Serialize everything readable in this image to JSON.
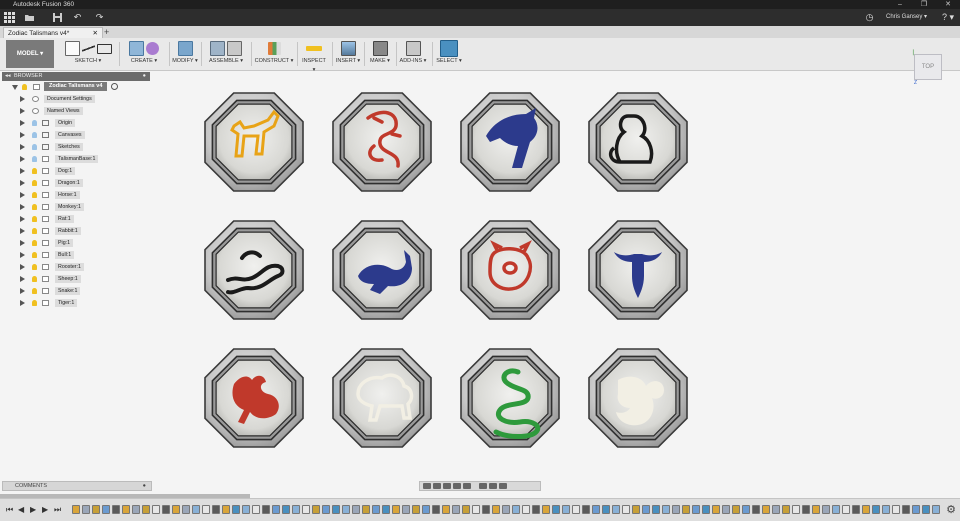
{
  "app": {
    "title": "Autodesk Fusion 360",
    "window_controls": [
      "–",
      "❐",
      "✕"
    ]
  },
  "qat": {
    "user": "Chris Gansey ▾",
    "help": "? ▾"
  },
  "tab": {
    "label": "Zodiac Talismans v4*",
    "close": "✕",
    "new_tab": "+"
  },
  "toolbar": {
    "workspace": "MODEL ▾",
    "groups": [
      "SKETCH ▾",
      "CREATE ▾",
      "MODIFY ▾",
      "ASSEMBLE ▾",
      "CONSTRUCT ▾",
      "INSPECT ▾",
      "INSERT ▾",
      "MAKE ▾",
      "ADD-INS ▾",
      "SELECT ▾"
    ]
  },
  "browser": {
    "header": "BROWSER",
    "root": "Zodiac Talismans v4",
    "items": [
      "Document Settings",
      "Named Views",
      "Origin",
      "Canvases",
      "Sketches",
      "TalismanBase:1",
      "Dog:1",
      "Dragon:1",
      "Horse:1",
      "Monkey:1",
      "Rat:1",
      "Rabbit:1",
      "Pig:1",
      "Bull:1",
      "Rooster:1",
      "Sheep:1",
      "Snake:1",
      "Tiger:1"
    ]
  },
  "viewcube": {
    "face": "TOP",
    "axis_x": "X",
    "axis_z": "Z"
  },
  "comments": {
    "label": "COMMENTS"
  },
  "talismans": [
    {
      "name": "Dog",
      "color": "#e8a317"
    },
    {
      "name": "Dragon",
      "color": "#c0392b"
    },
    {
      "name": "Horse",
      "color": "#2c3a8c"
    },
    {
      "name": "Monkey",
      "color": "#1a1a1a"
    },
    {
      "name": "Rat",
      "color": "#1a1a1a"
    },
    {
      "name": "Rabbit",
      "color": "#2c3a8c"
    },
    {
      "name": "Pig",
      "color": "#c0392b"
    },
    {
      "name": "Bull",
      "color": "#2c3a8c"
    },
    {
      "name": "Rooster",
      "color": "#c0392b"
    },
    {
      "name": "Sheep",
      "color": "#f2efe4"
    },
    {
      "name": "Snake",
      "color": "#2e9a3c"
    },
    {
      "name": "Tiger",
      "color": "#f2efe4"
    }
  ],
  "colors": {
    "titlebar": "#1f1f1f",
    "toolbar": "#e9e9e9",
    "select_group": "#4a90c0"
  },
  "icons": {
    "app_grid": "grid-icon",
    "save": "save-icon",
    "undo": "undo-icon",
    "redo": "redo-icon",
    "clock": "clock-icon",
    "settings": "gear-icon"
  }
}
